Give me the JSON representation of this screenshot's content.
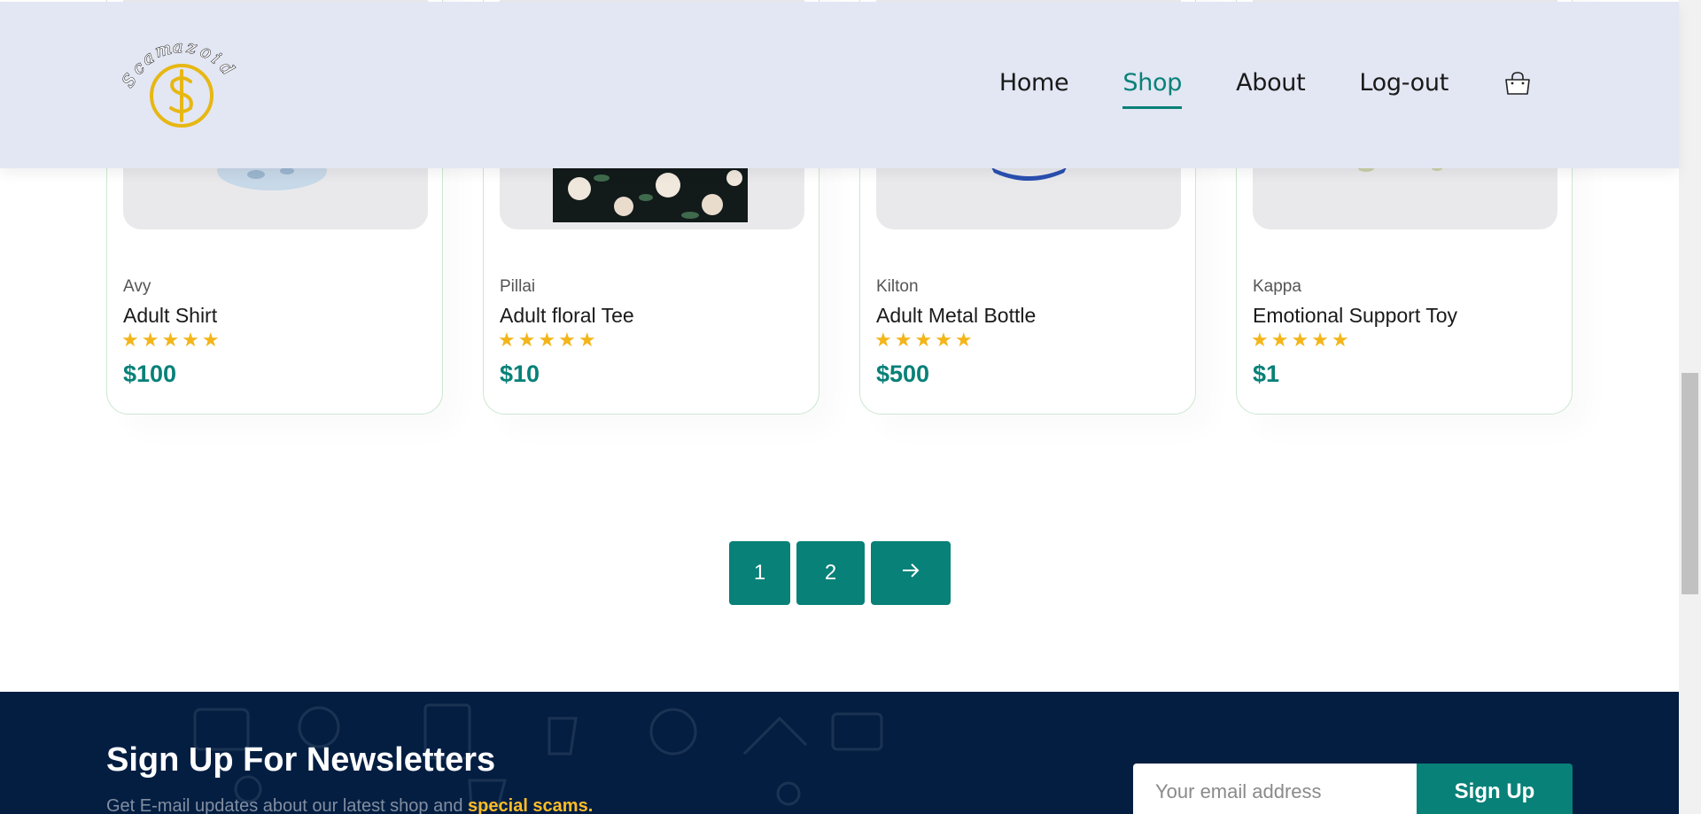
{
  "header": {
    "logo_text": "Scamazoid",
    "nav": [
      {
        "label": "Home",
        "active": false
      },
      {
        "label": "Shop",
        "active": true
      },
      {
        "label": "About",
        "active": false
      },
      {
        "label": "Log-out",
        "active": false
      }
    ],
    "cart_icon": "shopping-bag-icon"
  },
  "products": [
    {
      "brand": "Avy",
      "name": "Adult Shirt",
      "rating": 5,
      "stars": "★★★★★",
      "price": "$100"
    },
    {
      "brand": "Pillai",
      "name": "Adult floral Tee",
      "rating": 5,
      "stars": "★★★★★",
      "price": "$10"
    },
    {
      "brand": "Kilton",
      "name": "Adult Metal Bottle",
      "rating": 5,
      "stars": "★★★★★",
      "price": "$500"
    },
    {
      "brand": "Kappa",
      "name": "Emotional Support Toy",
      "rating": 5,
      "stars": "★★★★★",
      "price": "$1"
    }
  ],
  "pagination": {
    "pages": [
      "1",
      "2"
    ],
    "next_icon": "arrow-right-icon"
  },
  "newsletter": {
    "title": "Sign Up For Newsletters",
    "subtitle_prefix": "Get E-mail updates about our latest shop and",
    "subtitle_highlight": "special scams.",
    "email_placeholder": "Your email address",
    "button_label": "Sign Up"
  },
  "colors": {
    "accent": "#088178",
    "header_bg": "#e3e6f3",
    "star": "#f3b519",
    "newsletter_bg": "#041e42",
    "highlight": "#ffbd27"
  }
}
